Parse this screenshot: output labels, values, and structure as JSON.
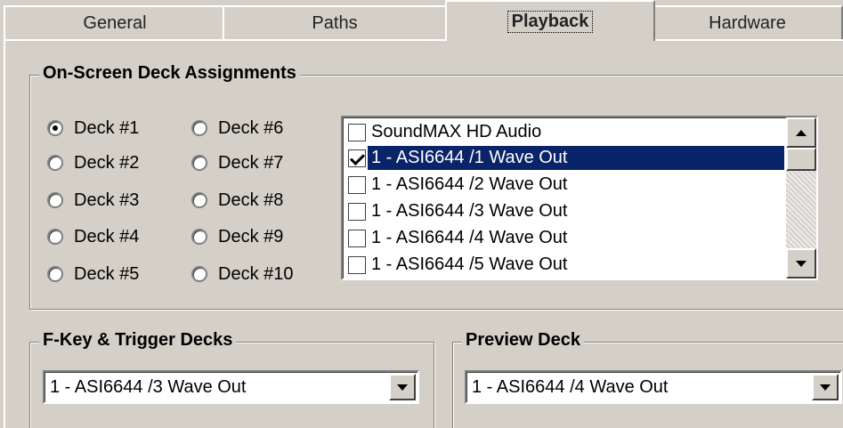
{
  "tabs": [
    {
      "label": "General",
      "active": false
    },
    {
      "label": "Paths",
      "active": false
    },
    {
      "label": "Playback",
      "active": true
    },
    {
      "label": "Hardware",
      "active": false
    }
  ],
  "deck_group": {
    "title": "On-Screen Deck Assignments",
    "radios": [
      {
        "label": "Deck #1",
        "checked": true
      },
      {
        "label": "Deck #2",
        "checked": false
      },
      {
        "label": "Deck #3",
        "checked": false
      },
      {
        "label": "Deck #4",
        "checked": false
      },
      {
        "label": "Deck #5",
        "checked": false
      },
      {
        "label": "Deck #6",
        "checked": false
      },
      {
        "label": "Deck #7",
        "checked": false
      },
      {
        "label": "Deck #8",
        "checked": false
      },
      {
        "label": "Deck #9",
        "checked": false
      },
      {
        "label": "Deck #10",
        "checked": false
      }
    ],
    "devices": [
      {
        "label": "SoundMAX HD Audio",
        "checked": false,
        "selected": false
      },
      {
        "label": "1 - ASI6644 /1 Wave Out",
        "checked": true,
        "selected": true
      },
      {
        "label": "1 - ASI6644 /2 Wave Out",
        "checked": false,
        "selected": false
      },
      {
        "label": "1 - ASI6644 /3 Wave Out",
        "checked": false,
        "selected": false
      },
      {
        "label": "1 - ASI6644 /4 Wave Out",
        "checked": false,
        "selected": false
      },
      {
        "label": "1 - ASI6644 /5 Wave Out",
        "checked": false,
        "selected": false
      }
    ]
  },
  "fkey_group": {
    "title": "F-Key & Trigger Decks",
    "value": "1 - ASI6644 /3 Wave Out"
  },
  "preview_group": {
    "title": "Preview Deck",
    "value": "1 - ASI6644 /4 Wave Out"
  },
  "colors": {
    "face": "#d4d0c8",
    "selection": "#0a246a"
  }
}
